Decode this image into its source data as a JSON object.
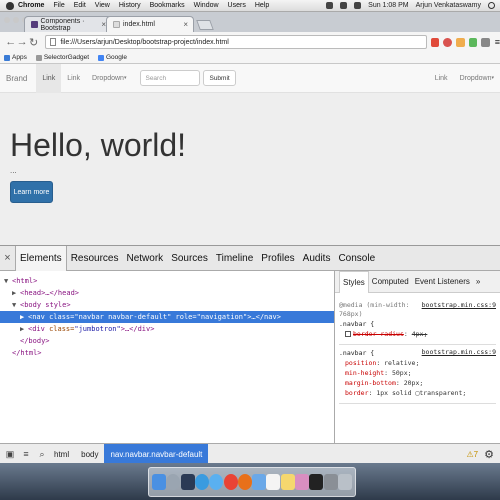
{
  "menubar": {
    "app_name": "Chrome",
    "items": [
      "File",
      "Edit",
      "View",
      "History",
      "Bookmarks",
      "Window",
      "Users",
      "Help"
    ],
    "time": "Sun 1:08 PM",
    "user": "Arjun Venkataswamy"
  },
  "tabs": [
    {
      "title": "Components · Bootstrap",
      "active": false,
      "favicon_color": "#563d7c"
    },
    {
      "title": "index.html",
      "active": true,
      "favicon_color": "#dddddd"
    }
  ],
  "address_bar": {
    "url": "file:///Users/arjun/Desktop/bootstrap-project/index.html"
  },
  "bookmarks": [
    {
      "label": "Apps",
      "color": "#3a7bd5"
    },
    {
      "label": "SelectorGadget",
      "color": "#999999"
    },
    {
      "label": "Google",
      "color": "#4285f4"
    }
  ],
  "page": {
    "navbar": {
      "brand": "Brand",
      "links_left": [
        "Link",
        "Link"
      ],
      "dropdown_left": "Dropdown",
      "search_placeholder": "Search",
      "submit": "Submit",
      "link_right": "Link",
      "dropdown_right": "Dropdown"
    },
    "jumbotron": {
      "heading": "Hello, world!",
      "text": "...",
      "button": "Learn more"
    }
  },
  "devtools": {
    "tabs": [
      "Elements",
      "Resources",
      "Network",
      "Sources",
      "Timeline",
      "Profiles",
      "Audits",
      "Console"
    ],
    "active_tab": "Elements",
    "dom": {
      "html_open": "<html>",
      "head": "<head>…</head>",
      "body_open": "<body style>",
      "nav_tag_open": "<nav ",
      "nav_class_attr": "class=",
      "nav_class_val": "\"navbar navbar-default\"",
      "nav_role_attr": " role=",
      "nav_role_val": "\"navigation\"",
      "nav_close": ">…</nav>",
      "div_tag_open": "<div ",
      "div_class_attr": "class=",
      "div_class_val": "\"jumbotron\"",
      "div_close": ">…</div>",
      "body_close": "</body>",
      "html_close": "</html>"
    },
    "sidebar_tabs": [
      "Styles",
      "Computed",
      "Event Listeners",
      "»"
    ],
    "styles": {
      "media_query": "@media (min-width:",
      "media_query_2": "768px)",
      "rule1_selector": ".navbar {",
      "rule1_src": "bootstrap.min.css:9",
      "rule1_decl_prop": "border-radius",
      "rule1_decl_val": "4px;",
      "rule2_selector": ".navbar {",
      "rule2_src": "bootstrap.min.css:9",
      "rule2_decls": [
        {
          "prop": "position",
          "val": "relative;"
        },
        {
          "prop": "min-height",
          "val": "50px;"
        },
        {
          "prop": "margin-bottom",
          "val": "20px;"
        },
        {
          "prop": "border",
          "val": "1px solid ▢transparent;"
        }
      ]
    },
    "breadcrumbs": [
      "html",
      "body",
      "nav.navbar.navbar-default"
    ],
    "warnings": "7"
  },
  "colors": {
    "selection": "#3879d9",
    "learn_button": "#3071a9",
    "tag": "#881280"
  }
}
